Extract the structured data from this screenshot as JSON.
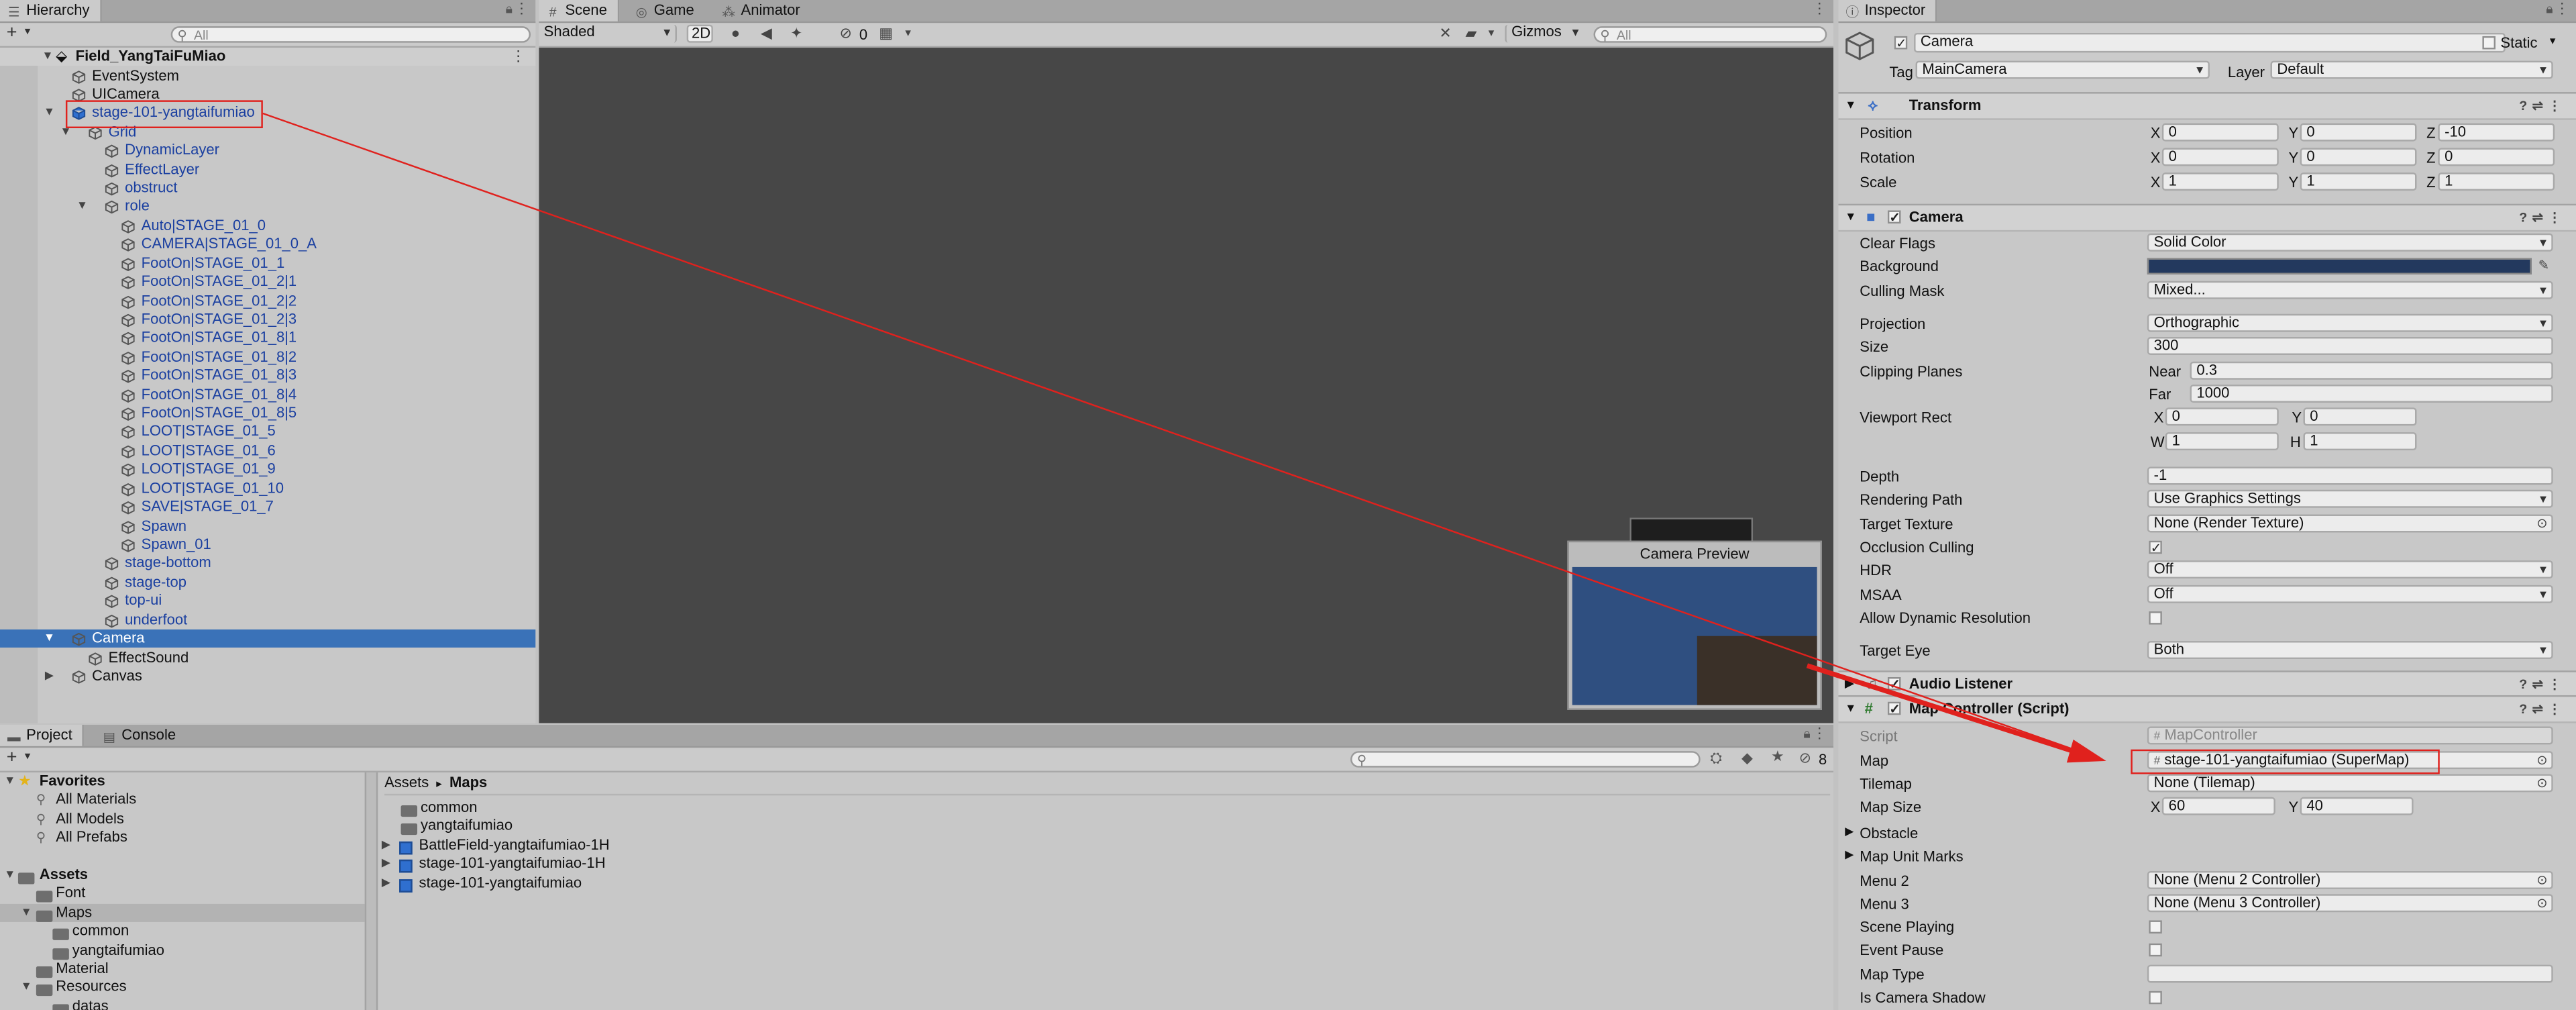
{
  "hierarchy": {
    "tab": "Hierarchy",
    "search_placeholder": "All",
    "scene_name": "Field_YangTaiFuMiao",
    "rows": [
      {
        "label": "EventSystem",
        "depth": 1,
        "color": "black",
        "tri": ""
      },
      {
        "label": "UICamera",
        "depth": 1,
        "color": "black",
        "tri": ""
      },
      {
        "label": "stage-101-yangtaifumiao",
        "depth": 1,
        "color": "blue",
        "tri": "▼",
        "prefab": true
      },
      {
        "label": "Grid",
        "depth": 2,
        "color": "blue",
        "tri": "▼"
      },
      {
        "label": "DynamicLayer",
        "depth": 3,
        "color": "blue",
        "tri": ""
      },
      {
        "label": "EffectLayer",
        "depth": 3,
        "color": "blue",
        "tri": ""
      },
      {
        "label": "obstruct",
        "depth": 3,
        "color": "blue",
        "tri": ""
      },
      {
        "label": "role",
        "depth": 3,
        "color": "blue",
        "tri": "▼"
      },
      {
        "label": "Auto|STAGE_01_0",
        "depth": 4,
        "color": "blue",
        "tri": ""
      },
      {
        "label": "CAMERA|STAGE_01_0_A",
        "depth": 4,
        "color": "blue",
        "tri": ""
      },
      {
        "label": "FootOn|STAGE_01_1",
        "depth": 4,
        "color": "blue",
        "tri": ""
      },
      {
        "label": "FootOn|STAGE_01_2|1",
        "depth": 4,
        "color": "blue",
        "tri": ""
      },
      {
        "label": "FootOn|STAGE_01_2|2",
        "depth": 4,
        "color": "blue",
        "tri": ""
      },
      {
        "label": "FootOn|STAGE_01_2|3",
        "depth": 4,
        "color": "blue",
        "tri": ""
      },
      {
        "label": "FootOn|STAGE_01_8|1",
        "depth": 4,
        "color": "blue",
        "tri": ""
      },
      {
        "label": "FootOn|STAGE_01_8|2",
        "depth": 4,
        "color": "blue",
        "tri": ""
      },
      {
        "label": "FootOn|STAGE_01_8|3",
        "depth": 4,
        "color": "blue",
        "tri": ""
      },
      {
        "label": "FootOn|STAGE_01_8|4",
        "depth": 4,
        "color": "blue",
        "tri": ""
      },
      {
        "label": "FootOn|STAGE_01_8|5",
        "depth": 4,
        "color": "blue",
        "tri": ""
      },
      {
        "label": "LOOT|STAGE_01_5",
        "depth": 4,
        "color": "blue",
        "tri": ""
      },
      {
        "label": "LOOT|STAGE_01_6",
        "depth": 4,
        "color": "blue",
        "tri": ""
      },
      {
        "label": "LOOT|STAGE_01_9",
        "depth": 4,
        "color": "blue",
        "tri": ""
      },
      {
        "label": "LOOT|STAGE_01_10",
        "depth": 4,
        "color": "blue",
        "tri": ""
      },
      {
        "label": "SAVE|STAGE_01_7",
        "depth": 4,
        "color": "blue",
        "tri": ""
      },
      {
        "label": "Spawn",
        "depth": 4,
        "color": "blue",
        "tri": ""
      },
      {
        "label": "Spawn_01",
        "depth": 4,
        "color": "blue",
        "tri": ""
      },
      {
        "label": "stage-bottom",
        "depth": 3,
        "color": "blue",
        "tri": ""
      },
      {
        "label": "stage-top",
        "depth": 3,
        "color": "blue",
        "tri": ""
      },
      {
        "label": "top-ui",
        "depth": 3,
        "color": "blue",
        "tri": ""
      },
      {
        "label": "underfoot",
        "depth": 3,
        "color": "blue",
        "tri": ""
      },
      {
        "label": "Camera",
        "depth": 1,
        "color": "black",
        "tri": "▼",
        "selected": true
      },
      {
        "label": "EffectSound",
        "depth": 2,
        "color": "black",
        "tri": ""
      },
      {
        "label": "Canvas",
        "depth": 1,
        "color": "black",
        "tri": "▶"
      }
    ]
  },
  "scene": {
    "tabs": [
      "Scene",
      "Game",
      "Animator"
    ],
    "shading": "Shaded",
    "mode_2d": "2D",
    "hidden_count": "0",
    "gizmos": "Gizmos",
    "search_placeholder": "All",
    "preview_title": "Camera Preview",
    "bg_color": "#474747",
    "preview_bg": "#2f4f80"
  },
  "inspector": {
    "tab": "Inspector",
    "object_name": "Camera",
    "static_label": "Static",
    "tag_label": "Tag",
    "tag_value": "MainCamera",
    "layer_label": "Layer",
    "layer_value": "Default",
    "transform": {
      "title": "Transform",
      "rows": [
        {
          "label": "Position",
          "x": "0",
          "y": "0",
          "z": "-10"
        },
        {
          "label": "Rotation",
          "x": "0",
          "y": "0",
          "z": "0"
        },
        {
          "label": "Scale",
          "x": "1",
          "y": "1",
          "z": "1"
        }
      ]
    },
    "camera": {
      "title": "Camera",
      "clear_flags_label": "Clear Flags",
      "clear_flags": "Solid Color",
      "background_label": "Background",
      "background_color": "#23395e",
      "culling_label": "Culling Mask",
      "culling": "Mixed...",
      "projection_label": "Projection",
      "projection": "Orthographic",
      "size_label": "Size",
      "size": "300",
      "clipping_label": "Clipping Planes",
      "near_label": "Near",
      "near": "0.3",
      "far_label": "Far",
      "far": "1000",
      "viewport_label": "Viewport Rect",
      "vx": "0",
      "vy": "0",
      "vw": "1",
      "vh": "1",
      "depth_label": "Depth",
      "depth": "-1",
      "render_path_label": "Rendering Path",
      "render_path": "Use Graphics Settings",
      "target_tex_label": "Target Texture",
      "target_tex": "None (Render Texture)",
      "occlusion_label": "Occlusion Culling",
      "hdr_label": "HDR",
      "hdr": "Off",
      "msaa_label": "MSAA",
      "msaa": "Off",
      "dyn_res_label": "Allow Dynamic Resolution",
      "target_eye_label": "Target Eye",
      "target_eye": "Both"
    },
    "audio_listener": {
      "title": "Audio Listener"
    },
    "map_controller": {
      "title": "Map Controller (Script)",
      "script_label": "Script",
      "script": "MapController",
      "map_label": "Map",
      "map": "stage-101-yangtaifumiao (SuperMap)",
      "tilemap_label": "Tilemap",
      "tilemap": "None (Tilemap)",
      "map_size_label": "Map Size",
      "map_size_x": "60",
      "map_size_y": "40",
      "obstacle_label": "Obstacle",
      "map_unit_marks_label": "Map Unit Marks",
      "menu2_label": "Menu 2",
      "menu2": "None (Menu 2 Controller)",
      "menu3_label": "Menu 3",
      "menu3": "None (Menu 3 Controller)",
      "scene_playing_label": "Scene Playing",
      "event_pause_label": "Event Pause",
      "map_type_label": "Map Type",
      "camera_shadow_label": "Is Camera Shadow"
    }
  },
  "project": {
    "tabs": [
      "Project",
      "Console"
    ],
    "hidden_count": "8",
    "favorites_label": "Favorites",
    "favorites": [
      "All Materials",
      "All Models",
      "All Prefabs"
    ],
    "assets_label": "Assets",
    "tree": [
      {
        "label": "Font",
        "depth": 1,
        "tri": ""
      },
      {
        "label": "Maps",
        "depth": 1,
        "tri": "▼",
        "selected": true
      },
      {
        "label": "common",
        "depth": 2,
        "tri": ""
      },
      {
        "label": "yangtaifumiao",
        "depth": 2,
        "tri": ""
      },
      {
        "label": "Material",
        "depth": 1,
        "tri": ""
      },
      {
        "label": "Resources",
        "depth": 1,
        "tri": "▼"
      },
      {
        "label": "datas",
        "depth": 2,
        "tri": ""
      }
    ],
    "breadcrumb_root": "Assets",
    "breadcrumb_sep": "▸",
    "breadcrumb_leaf": "Maps",
    "items": [
      {
        "label": "common",
        "type": "folder"
      },
      {
        "label": "yangtaifumiao",
        "type": "folder"
      },
      {
        "label": "BattleField-yangtaifumiao-1H",
        "type": "prefab"
      },
      {
        "label": "stage-101-yangtaifumiao-1H",
        "type": "prefab"
      },
      {
        "label": "stage-101-yangtaifumiao",
        "type": "prefab"
      }
    ]
  }
}
